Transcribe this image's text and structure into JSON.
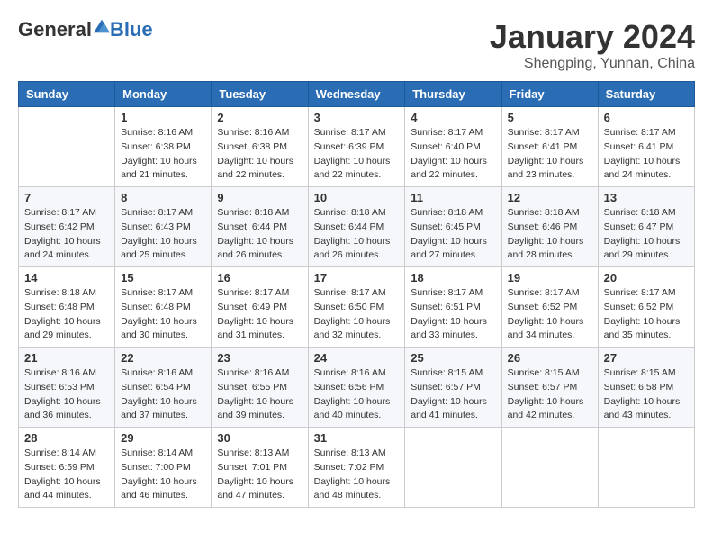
{
  "header": {
    "logo": {
      "general": "General",
      "blue": "Blue"
    },
    "title": "January 2024",
    "location": "Shengping, Yunnan, China"
  },
  "calendar": {
    "days_of_week": [
      "Sunday",
      "Monday",
      "Tuesday",
      "Wednesday",
      "Thursday",
      "Friday",
      "Saturday"
    ],
    "weeks": [
      [
        {
          "day": "",
          "sunrise": "",
          "sunset": "",
          "daylight": ""
        },
        {
          "day": "1",
          "sunrise": "Sunrise: 8:16 AM",
          "sunset": "Sunset: 6:38 PM",
          "daylight": "Daylight: 10 hours and 21 minutes."
        },
        {
          "day": "2",
          "sunrise": "Sunrise: 8:16 AM",
          "sunset": "Sunset: 6:38 PM",
          "daylight": "Daylight: 10 hours and 22 minutes."
        },
        {
          "day": "3",
          "sunrise": "Sunrise: 8:17 AM",
          "sunset": "Sunset: 6:39 PM",
          "daylight": "Daylight: 10 hours and 22 minutes."
        },
        {
          "day": "4",
          "sunrise": "Sunrise: 8:17 AM",
          "sunset": "Sunset: 6:40 PM",
          "daylight": "Daylight: 10 hours and 22 minutes."
        },
        {
          "day": "5",
          "sunrise": "Sunrise: 8:17 AM",
          "sunset": "Sunset: 6:41 PM",
          "daylight": "Daylight: 10 hours and 23 minutes."
        },
        {
          "day": "6",
          "sunrise": "Sunrise: 8:17 AM",
          "sunset": "Sunset: 6:41 PM",
          "daylight": "Daylight: 10 hours and 24 minutes."
        }
      ],
      [
        {
          "day": "7",
          "sunrise": "Sunrise: 8:17 AM",
          "sunset": "Sunset: 6:42 PM",
          "daylight": "Daylight: 10 hours and 24 minutes."
        },
        {
          "day": "8",
          "sunrise": "Sunrise: 8:17 AM",
          "sunset": "Sunset: 6:43 PM",
          "daylight": "Daylight: 10 hours and 25 minutes."
        },
        {
          "day": "9",
          "sunrise": "Sunrise: 8:18 AM",
          "sunset": "Sunset: 6:44 PM",
          "daylight": "Daylight: 10 hours and 26 minutes."
        },
        {
          "day": "10",
          "sunrise": "Sunrise: 8:18 AM",
          "sunset": "Sunset: 6:44 PM",
          "daylight": "Daylight: 10 hours and 26 minutes."
        },
        {
          "day": "11",
          "sunrise": "Sunrise: 8:18 AM",
          "sunset": "Sunset: 6:45 PM",
          "daylight": "Daylight: 10 hours and 27 minutes."
        },
        {
          "day": "12",
          "sunrise": "Sunrise: 8:18 AM",
          "sunset": "Sunset: 6:46 PM",
          "daylight": "Daylight: 10 hours and 28 minutes."
        },
        {
          "day": "13",
          "sunrise": "Sunrise: 8:18 AM",
          "sunset": "Sunset: 6:47 PM",
          "daylight": "Daylight: 10 hours and 29 minutes."
        }
      ],
      [
        {
          "day": "14",
          "sunrise": "Sunrise: 8:18 AM",
          "sunset": "Sunset: 6:48 PM",
          "daylight": "Daylight: 10 hours and 29 minutes."
        },
        {
          "day": "15",
          "sunrise": "Sunrise: 8:17 AM",
          "sunset": "Sunset: 6:48 PM",
          "daylight": "Daylight: 10 hours and 30 minutes."
        },
        {
          "day": "16",
          "sunrise": "Sunrise: 8:17 AM",
          "sunset": "Sunset: 6:49 PM",
          "daylight": "Daylight: 10 hours and 31 minutes."
        },
        {
          "day": "17",
          "sunrise": "Sunrise: 8:17 AM",
          "sunset": "Sunset: 6:50 PM",
          "daylight": "Daylight: 10 hours and 32 minutes."
        },
        {
          "day": "18",
          "sunrise": "Sunrise: 8:17 AM",
          "sunset": "Sunset: 6:51 PM",
          "daylight": "Daylight: 10 hours and 33 minutes."
        },
        {
          "day": "19",
          "sunrise": "Sunrise: 8:17 AM",
          "sunset": "Sunset: 6:52 PM",
          "daylight": "Daylight: 10 hours and 34 minutes."
        },
        {
          "day": "20",
          "sunrise": "Sunrise: 8:17 AM",
          "sunset": "Sunset: 6:52 PM",
          "daylight": "Daylight: 10 hours and 35 minutes."
        }
      ],
      [
        {
          "day": "21",
          "sunrise": "Sunrise: 8:16 AM",
          "sunset": "Sunset: 6:53 PM",
          "daylight": "Daylight: 10 hours and 36 minutes."
        },
        {
          "day": "22",
          "sunrise": "Sunrise: 8:16 AM",
          "sunset": "Sunset: 6:54 PM",
          "daylight": "Daylight: 10 hours and 37 minutes."
        },
        {
          "day": "23",
          "sunrise": "Sunrise: 8:16 AM",
          "sunset": "Sunset: 6:55 PM",
          "daylight": "Daylight: 10 hours and 39 minutes."
        },
        {
          "day": "24",
          "sunrise": "Sunrise: 8:16 AM",
          "sunset": "Sunset: 6:56 PM",
          "daylight": "Daylight: 10 hours and 40 minutes."
        },
        {
          "day": "25",
          "sunrise": "Sunrise: 8:15 AM",
          "sunset": "Sunset: 6:57 PM",
          "daylight": "Daylight: 10 hours and 41 minutes."
        },
        {
          "day": "26",
          "sunrise": "Sunrise: 8:15 AM",
          "sunset": "Sunset: 6:57 PM",
          "daylight": "Daylight: 10 hours and 42 minutes."
        },
        {
          "day": "27",
          "sunrise": "Sunrise: 8:15 AM",
          "sunset": "Sunset: 6:58 PM",
          "daylight": "Daylight: 10 hours and 43 minutes."
        }
      ],
      [
        {
          "day": "28",
          "sunrise": "Sunrise: 8:14 AM",
          "sunset": "Sunset: 6:59 PM",
          "daylight": "Daylight: 10 hours and 44 minutes."
        },
        {
          "day": "29",
          "sunrise": "Sunrise: 8:14 AM",
          "sunset": "Sunset: 7:00 PM",
          "daylight": "Daylight: 10 hours and 46 minutes."
        },
        {
          "day": "30",
          "sunrise": "Sunrise: 8:13 AM",
          "sunset": "Sunset: 7:01 PM",
          "daylight": "Daylight: 10 hours and 47 minutes."
        },
        {
          "day": "31",
          "sunrise": "Sunrise: 8:13 AM",
          "sunset": "Sunset: 7:02 PM",
          "daylight": "Daylight: 10 hours and 48 minutes."
        },
        {
          "day": "",
          "sunrise": "",
          "sunset": "",
          "daylight": ""
        },
        {
          "day": "",
          "sunrise": "",
          "sunset": "",
          "daylight": ""
        },
        {
          "day": "",
          "sunrise": "",
          "sunset": "",
          "daylight": ""
        }
      ]
    ]
  }
}
